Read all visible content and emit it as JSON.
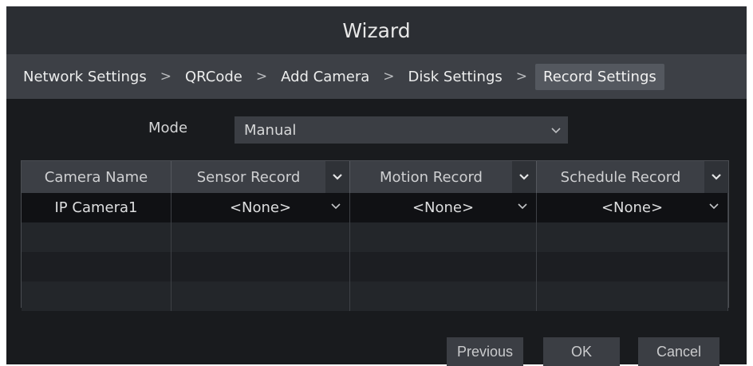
{
  "window": {
    "title": "Wizard"
  },
  "wizard_steps": [
    {
      "label": "Network Settings",
      "active": false
    },
    {
      "label": "QRCode",
      "active": false
    },
    {
      "label": "Add Camera",
      "active": false
    },
    {
      "label": "Disk Settings",
      "active": false
    },
    {
      "label": "Record Settings",
      "active": true
    }
  ],
  "separator": ">",
  "mode": {
    "label": "Mode",
    "value": "Manual"
  },
  "table": {
    "headers": [
      "Camera Name",
      "Sensor Record",
      "Motion Record",
      "Schedule Record"
    ],
    "rows": [
      [
        "IP Camera1",
        "<None>",
        "<None>",
        "<None>"
      ],
      [
        "",
        "",
        "",
        ""
      ],
      [
        "",
        "",
        "",
        ""
      ],
      [
        "",
        "",
        "",
        ""
      ]
    ]
  },
  "buttons": {
    "previous": "Previous",
    "ok": "OK",
    "cancel": "Cancel"
  },
  "colors": {
    "window_bg": "#191b1e",
    "titlebar_bg": "#2b2e33",
    "nav_bg": "#3d4046",
    "active_step_bg": "#54585f",
    "control_bg": "#3b3e44"
  }
}
